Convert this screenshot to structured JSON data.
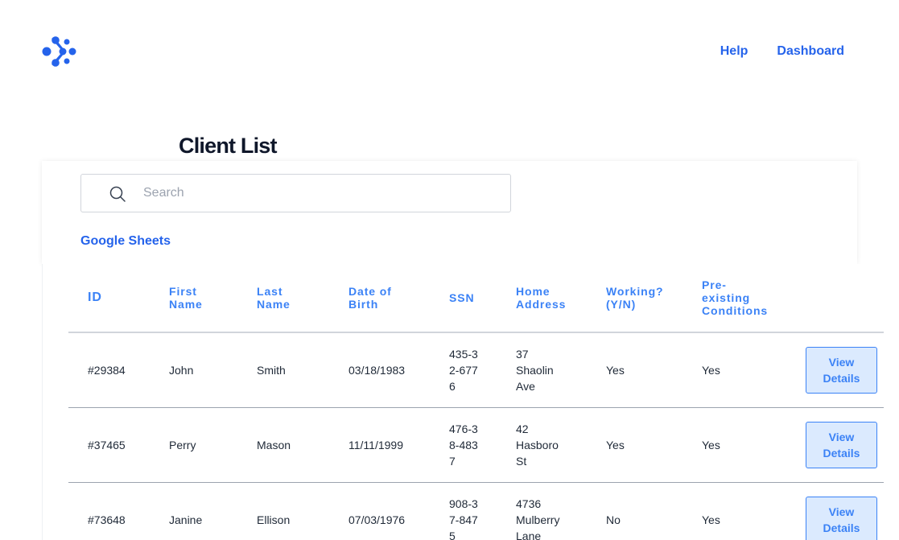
{
  "brand": {
    "logo_icon": "chevron-dots-logo-icon",
    "accent": "#2563eb"
  },
  "nav": {
    "help": "Help",
    "dashboard": "Dashboard"
  },
  "page_title": "Client List",
  "search": {
    "placeholder": "Search",
    "value": ""
  },
  "google_sheets_link": "Google Sheets",
  "table": {
    "headers": {
      "id": "ID",
      "first_name": "First Name",
      "last_name": "Last Name",
      "dob": "Date of Birth",
      "ssn": "SSN",
      "home_address": "Home Address",
      "working": "Working? (Y/N)",
      "preexisting": "Pre-existing Conditions"
    },
    "rows": [
      {
        "id": "#29384",
        "first_name": "John",
        "last_name": "Smith",
        "dob": "03/18/1983",
        "ssn": "435-32-6776",
        "address": "37 Shaolin Ave",
        "working": "Yes",
        "preexisting": "Yes",
        "action": "View Details"
      },
      {
        "id": "#37465",
        "first_name": "Perry",
        "last_name": "Mason",
        "dob": "11/11/1999",
        "ssn": "476-38-4837",
        "address": "42 Hasboro St",
        "working": "Yes",
        "preexisting": "Yes",
        "action": "View Details"
      },
      {
        "id": "#73648",
        "first_name": "Janine",
        "last_name": "Ellison",
        "dob": "07/03/1976",
        "ssn": "908-37-8475",
        "address": "4736 Mulberry Lane",
        "working": "No",
        "preexisting": "Yes",
        "action": "View Details"
      }
    ]
  }
}
